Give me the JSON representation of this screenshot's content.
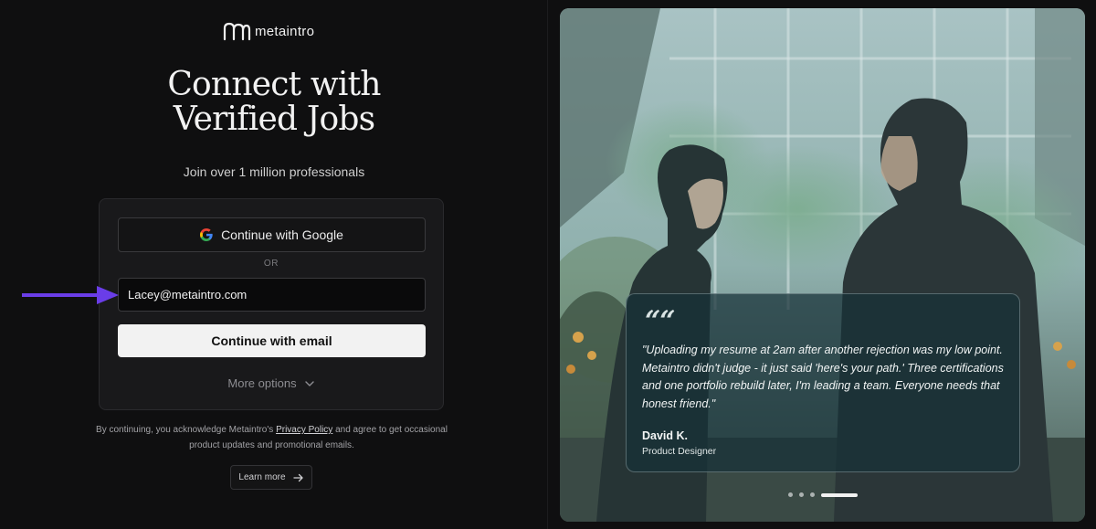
{
  "brand": {
    "name": "metaintro"
  },
  "hero": {
    "title_line1": "Connect with",
    "title_line2": "Verified Jobs",
    "subtitle": "Join over 1 million professionals"
  },
  "auth": {
    "google_label": "Continue with Google",
    "divider": "OR",
    "email_value": "Lacey@metaintro.com",
    "email_button": "Continue with email",
    "more_options": "More options"
  },
  "legal": {
    "prefix": "By continuing, you acknowledge Metaintro's ",
    "link": "Privacy Policy",
    "suffix": " and agree to get occasional product updates and promotional emails.",
    "learn_more": "Learn more"
  },
  "testimonial": {
    "quote_mark": "““",
    "text": "\"Uploading my resume at 2am after another rejection was my low point. Metaintro didn't judge - it just said 'here's your path.' Three certifications and one portfolio rebuild later, I'm leading a team. Everyone needs that honest friend.\"",
    "author": "David K.",
    "role": "Product Designer",
    "slides": 4,
    "active_slide": 4
  },
  "icons": {
    "logo": "metaintro-logo-icon",
    "google": "google-g-icon",
    "chevron": "chevron-down-icon",
    "arrow": "arrow-right-icon",
    "pointer": "pointer-arrow-icon"
  },
  "colors": {
    "background": "#0f0f10",
    "card": "#19191b",
    "primary_button": "#f2f2f2",
    "pointer_arrow": "#6a3de8"
  }
}
